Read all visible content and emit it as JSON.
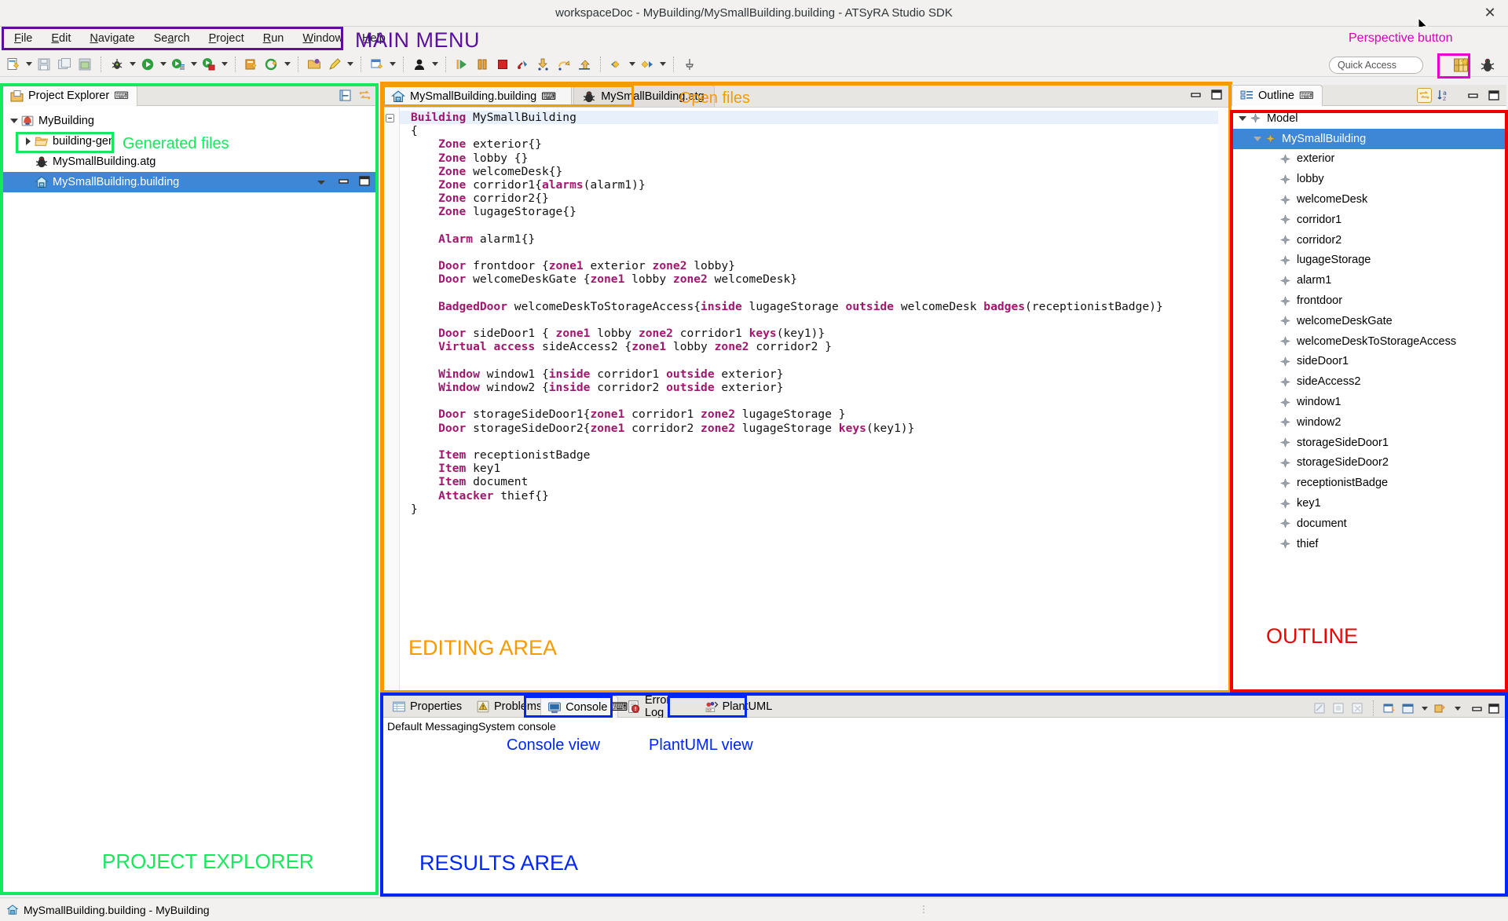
{
  "window": {
    "title": "workspaceDoc - MyBuilding/MySmallBuilding.building - ATSyRA Studio SDK",
    "close_glyph": "✕"
  },
  "menubar": {
    "items": [
      {
        "label": "File",
        "mnemonic": "F"
      },
      {
        "label": "Edit",
        "mnemonic": "E"
      },
      {
        "label": "Navigate",
        "mnemonic": "N"
      },
      {
        "label": "Search",
        "mnemonic": "a"
      },
      {
        "label": "Project",
        "mnemonic": "P"
      },
      {
        "label": "Run",
        "mnemonic": "R"
      },
      {
        "label": "Window",
        "mnemonic": "W"
      },
      {
        "label": "Help",
        "mnemonic": "H"
      }
    ]
  },
  "toolbar": {
    "quick_access_placeholder": "Quick Access"
  },
  "annotations": {
    "main_menu": "MAIN MENU",
    "perspective_button": "Perspective button",
    "generated_files": "Generated files",
    "project_explorer": "PROJECT EXPLORER",
    "open_files": "Open files",
    "editing_area": "EDITING AREA",
    "outline": "OUTLINE",
    "console_view": "Console view",
    "plantuml_view": "PlantUML view",
    "results_area": "RESULTS AREA",
    "colors": {
      "purple": "#5b0f9e",
      "magenta": "#e800d0",
      "green": "#15e85c",
      "orange": "#f59a00",
      "red": "#ef0000",
      "blue": "#0026f5"
    }
  },
  "project_explorer": {
    "tab_label": "Project Explorer",
    "close_glyph": "⌨",
    "tree": [
      {
        "label": "MyBuilding",
        "depth": 0,
        "twisty": "open",
        "icon": "project-icon",
        "selected": false
      },
      {
        "label": "building-gen",
        "depth": 1,
        "twisty": "closed",
        "icon": "folder-icon",
        "selected": false
      },
      {
        "label": "MySmallBuilding.atg",
        "depth": 1,
        "twisty": "none",
        "icon": "atg-file-icon",
        "selected": false
      },
      {
        "label": "MySmallBuilding.building",
        "depth": 1,
        "twisty": "none",
        "icon": "building-file-icon",
        "selected": true
      }
    ]
  },
  "editor": {
    "tabs": [
      {
        "label": "MySmallBuilding.building",
        "icon": "building-file-icon",
        "active": true,
        "close_glyph": "⌨"
      },
      {
        "label": "MySmallBuilding.atg",
        "icon": "atg-file-icon",
        "active": false,
        "close_glyph": ""
      }
    ],
    "code_lines": [
      [
        {
          "t": "Building",
          "k": true
        },
        {
          "t": " MySmallBuilding",
          "k": false
        }
      ],
      [
        {
          "t": "{",
          "k": false
        }
      ],
      [
        {
          "t": "    Zone",
          "k": true
        },
        {
          "t": " exterior{}",
          "k": false
        }
      ],
      [
        {
          "t": "    Zone",
          "k": true
        },
        {
          "t": " lobby {}",
          "k": false
        }
      ],
      [
        {
          "t": "    Zone",
          "k": true
        },
        {
          "t": " welcomeDesk{}",
          "k": false
        }
      ],
      [
        {
          "t": "    Zone",
          "k": true
        },
        {
          "t": " corridor1{",
          "k": false
        },
        {
          "t": "alarms",
          "k": true
        },
        {
          "t": "(alarm1)}",
          "k": false
        }
      ],
      [
        {
          "t": "    Zone",
          "k": true
        },
        {
          "t": " corridor2{}",
          "k": false
        }
      ],
      [
        {
          "t": "    Zone",
          "k": true
        },
        {
          "t": " lugageStorage{}",
          "k": false
        }
      ],
      [
        {
          "t": "",
          "k": false
        }
      ],
      [
        {
          "t": "    Alarm",
          "k": true
        },
        {
          "t": " alarm1{}",
          "k": false
        }
      ],
      [
        {
          "t": "",
          "k": false
        }
      ],
      [
        {
          "t": "    Door",
          "k": true
        },
        {
          "t": " frontdoor {",
          "k": false
        },
        {
          "t": "zone1",
          "k": true
        },
        {
          "t": " exterior ",
          "k": false
        },
        {
          "t": "zone2",
          "k": true
        },
        {
          "t": " lobby}",
          "k": false
        }
      ],
      [
        {
          "t": "    Door",
          "k": true
        },
        {
          "t": " welcomeDeskGate {",
          "k": false
        },
        {
          "t": "zone1",
          "k": true
        },
        {
          "t": " lobby ",
          "k": false
        },
        {
          "t": "zone2",
          "k": true
        },
        {
          "t": " welcomeDesk}",
          "k": false
        }
      ],
      [
        {
          "t": "",
          "k": false
        }
      ],
      [
        {
          "t": "    BadgedDoor",
          "k": true
        },
        {
          "t": " welcomeDeskToStorageAccess{",
          "k": false
        },
        {
          "t": "inside",
          "k": true
        },
        {
          "t": " lugageStorage ",
          "k": false
        },
        {
          "t": "outside",
          "k": true
        },
        {
          "t": " welcomeDesk ",
          "k": false
        },
        {
          "t": "badges",
          "k": true
        },
        {
          "t": "(receptionistBadge)}",
          "k": false
        }
      ],
      [
        {
          "t": "",
          "k": false
        }
      ],
      [
        {
          "t": "    Door",
          "k": true
        },
        {
          "t": " sideDoor1 { ",
          "k": false
        },
        {
          "t": "zone1",
          "k": true
        },
        {
          "t": " lobby ",
          "k": false
        },
        {
          "t": "zone2",
          "k": true
        },
        {
          "t": " corridor1 ",
          "k": false
        },
        {
          "t": "keys",
          "k": true
        },
        {
          "t": "(key1)}",
          "k": false
        }
      ],
      [
        {
          "t": "    Virtual",
          "k": true
        },
        {
          "t": " ",
          "k": false
        },
        {
          "t": "access",
          "k": true
        },
        {
          "t": " sideAccess2 {",
          "k": false
        },
        {
          "t": "zone1",
          "k": true
        },
        {
          "t": " lobby ",
          "k": false
        },
        {
          "t": "zone2",
          "k": true
        },
        {
          "t": " corridor2 }",
          "k": false
        }
      ],
      [
        {
          "t": "",
          "k": false
        }
      ],
      [
        {
          "t": "    Window",
          "k": true
        },
        {
          "t": " window1 {",
          "k": false
        },
        {
          "t": "inside",
          "k": true
        },
        {
          "t": " corridor1 ",
          "k": false
        },
        {
          "t": "outside",
          "k": true
        },
        {
          "t": " exterior}",
          "k": false
        }
      ],
      [
        {
          "t": "    Window",
          "k": true
        },
        {
          "t": " window2 {",
          "k": false
        },
        {
          "t": "inside",
          "k": true
        },
        {
          "t": " corridor2 ",
          "k": false
        },
        {
          "t": "outside",
          "k": true
        },
        {
          "t": " exterior}",
          "k": false
        }
      ],
      [
        {
          "t": "",
          "k": false
        }
      ],
      [
        {
          "t": "    Door",
          "k": true
        },
        {
          "t": " storageSideDoor1{",
          "k": false
        },
        {
          "t": "zone1",
          "k": true
        },
        {
          "t": " corridor1 ",
          "k": false
        },
        {
          "t": "zone2",
          "k": true
        },
        {
          "t": " lugageStorage }",
          "k": false
        }
      ],
      [
        {
          "t": "    Door",
          "k": true
        },
        {
          "t": " storageSideDoor2{",
          "k": false
        },
        {
          "t": "zone1",
          "k": true
        },
        {
          "t": " corridor2 ",
          "k": false
        },
        {
          "t": "zone2",
          "k": true
        },
        {
          "t": " lugageStorage ",
          "k": false
        },
        {
          "t": "keys",
          "k": true
        },
        {
          "t": "(key1)}",
          "k": false
        }
      ],
      [
        {
          "t": "",
          "k": false
        }
      ],
      [
        {
          "t": "    Item",
          "k": true
        },
        {
          "t": " receptionistBadge",
          "k": false
        }
      ],
      [
        {
          "t": "    Item",
          "k": true
        },
        {
          "t": " key1",
          "k": false
        }
      ],
      [
        {
          "t": "    Item",
          "k": true
        },
        {
          "t": " document",
          "k": false
        }
      ],
      [
        {
          "t": "    Attacker",
          "k": true
        },
        {
          "t": " thief{}",
          "k": false
        }
      ],
      [
        {
          "t": "}",
          "k": false
        }
      ]
    ]
  },
  "outline": {
    "tab_label": "Outline",
    "close_glyph": "⌨",
    "tree": [
      {
        "label": "Model",
        "depth": 0,
        "twisty": "open",
        "selected": false
      },
      {
        "label": "MySmallBuilding",
        "depth": 1,
        "twisty": "open",
        "selected": true
      },
      {
        "label": "exterior",
        "depth": 2,
        "twisty": "none",
        "selected": false
      },
      {
        "label": "lobby",
        "depth": 2,
        "twisty": "none",
        "selected": false
      },
      {
        "label": "welcomeDesk",
        "depth": 2,
        "twisty": "none",
        "selected": false
      },
      {
        "label": "corridor1",
        "depth": 2,
        "twisty": "none",
        "selected": false
      },
      {
        "label": "corridor2",
        "depth": 2,
        "twisty": "none",
        "selected": false
      },
      {
        "label": "lugageStorage",
        "depth": 2,
        "twisty": "none",
        "selected": false
      },
      {
        "label": "alarm1",
        "depth": 2,
        "twisty": "none",
        "selected": false
      },
      {
        "label": "frontdoor",
        "depth": 2,
        "twisty": "none",
        "selected": false
      },
      {
        "label": "welcomeDeskGate",
        "depth": 2,
        "twisty": "none",
        "selected": false
      },
      {
        "label": "welcomeDeskToStorageAccess",
        "depth": 2,
        "twisty": "none",
        "selected": false
      },
      {
        "label": "sideDoor1",
        "depth": 2,
        "twisty": "none",
        "selected": false
      },
      {
        "label": "sideAccess2",
        "depth": 2,
        "twisty": "none",
        "selected": false
      },
      {
        "label": "window1",
        "depth": 2,
        "twisty": "none",
        "selected": false
      },
      {
        "label": "window2",
        "depth": 2,
        "twisty": "none",
        "selected": false
      },
      {
        "label": "storageSideDoor1",
        "depth": 2,
        "twisty": "none",
        "selected": false
      },
      {
        "label": "storageSideDoor2",
        "depth": 2,
        "twisty": "none",
        "selected": false
      },
      {
        "label": "receptionistBadge",
        "depth": 2,
        "twisty": "none",
        "selected": false
      },
      {
        "label": "key1",
        "depth": 2,
        "twisty": "none",
        "selected": false
      },
      {
        "label": "document",
        "depth": 2,
        "twisty": "none",
        "selected": false
      },
      {
        "label": "thief",
        "depth": 2,
        "twisty": "none",
        "selected": false
      }
    ]
  },
  "results": {
    "tabs": [
      {
        "label": "Properties",
        "icon": "properties-icon",
        "active": false,
        "close_glyph": ""
      },
      {
        "label": "Problems",
        "icon": "problems-icon",
        "active": false,
        "close_glyph": ""
      },
      {
        "label": "Console",
        "icon": "console-icon",
        "active": true,
        "close_glyph": "⌨"
      },
      {
        "label": "Error Log",
        "icon": "error-log-icon",
        "active": false,
        "close_glyph": ""
      },
      {
        "label": "PlantUML",
        "icon": "plantuml-icon",
        "active": false,
        "close_glyph": ""
      }
    ],
    "console_text": "Default MessagingSystem console"
  },
  "statusbar": {
    "text": "MySmallBuilding.building - MyBuilding"
  }
}
